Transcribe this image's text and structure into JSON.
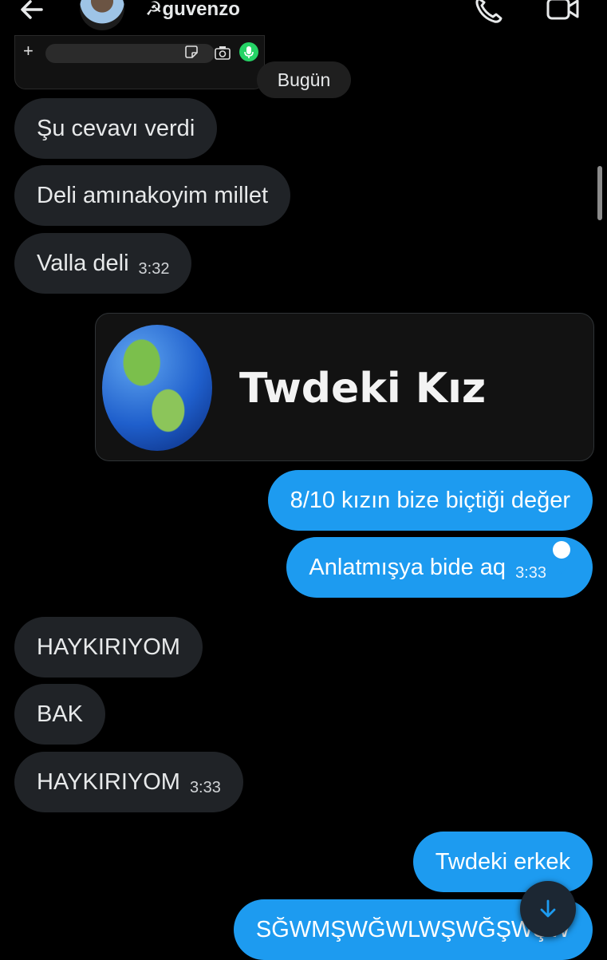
{
  "header": {
    "username": "☭guvenzo",
    "back_icon": "arrow-left-icon",
    "call_icon": "phone-icon",
    "video_icon": "video-camera-icon"
  },
  "date_separator": "Bugün",
  "messages": [
    {
      "direction": "incoming",
      "text": "Şu cevavı verdi",
      "time": ""
    },
    {
      "direction": "incoming",
      "text": "Deli amınakoyim millet",
      "time": ""
    },
    {
      "direction": "incoming",
      "text": "Valla deli",
      "time": "3:32"
    },
    {
      "direction": "outgoing",
      "type": "shared-card",
      "card_title": "Twdeki Kız"
    },
    {
      "direction": "outgoing",
      "text": "8/10 kızın bize biçtiği değer",
      "time": ""
    },
    {
      "direction": "outgoing",
      "text": "Anlatmışya bide aq",
      "time": "3:33",
      "read": true
    },
    {
      "direction": "incoming",
      "text": "HAYKIRIYOM",
      "time": ""
    },
    {
      "direction": "incoming",
      "text": "BAK",
      "time": ""
    },
    {
      "direction": "incoming",
      "text": "HAYKIRIYOM",
      "time": "3:33"
    },
    {
      "direction": "outgoing",
      "text": "Twdeki erkek",
      "time": ""
    },
    {
      "direction": "outgoing",
      "text": "SĞWMŞWĞWLWŞWĞŞWŞW",
      "time": ""
    }
  ],
  "colors": {
    "background": "#000000",
    "incoming_bubble": "#202327",
    "outgoing_bubble": "#1d9bf0",
    "accent": "#1d9bf0"
  },
  "scroll_to_bottom_icon": "arrow-down-icon"
}
